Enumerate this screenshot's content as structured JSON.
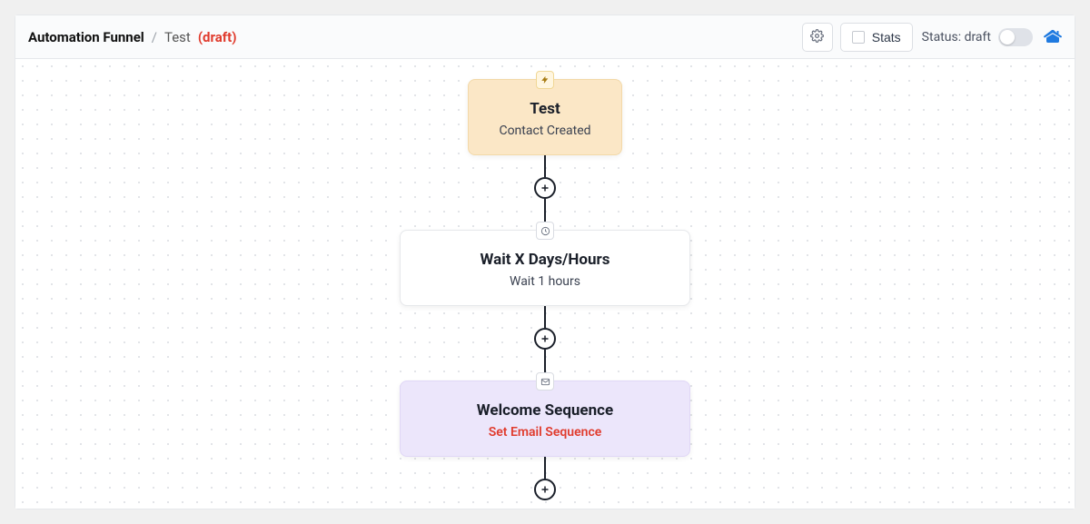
{
  "header": {
    "breadcrumb_title": "Automation Funnel",
    "separator": "/",
    "funnel_name": "Test",
    "draft_badge": "(draft)",
    "stats_label": "Stats",
    "status_label": "Status: draft"
  },
  "flow": {
    "trigger": {
      "title": "Test",
      "subtitle": "Contact Created"
    },
    "wait": {
      "title": "Wait X Days/Hours",
      "subtitle": "Wait 1 hours"
    },
    "sequence": {
      "title": "Welcome Sequence",
      "action": "Set Email Sequence"
    }
  }
}
